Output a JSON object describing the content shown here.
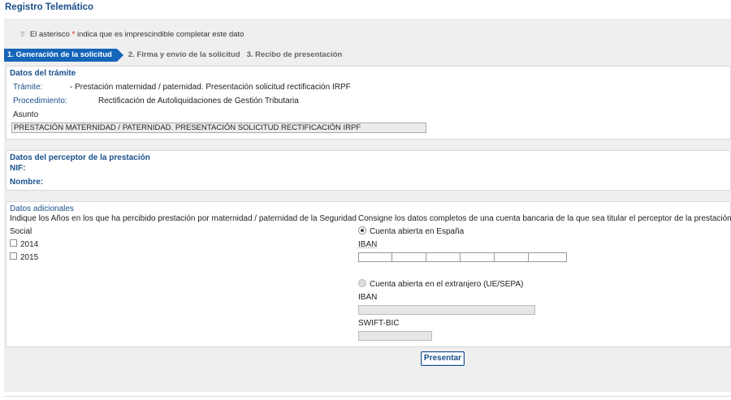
{
  "app_title": "Registro Telemático",
  "note": {
    "prefix": "El asterisco ",
    "asterisk": "*",
    "suffix": " indica que es imprescindible completar este dato"
  },
  "steps": [
    {
      "label": "1. Generación de la solicitud"
    },
    {
      "label": "2. Firma y envío de la solicitud"
    },
    {
      "label": "3. Recibo de presentación"
    }
  ],
  "tramite": {
    "section_title": "Datos del trámite",
    "tramite_label": "Trámite:",
    "tramite_value": "- Prestación maternidad / paternidad. Presentación solicitud rectificación IRPF",
    "procedimiento_label": "Procedimiento:",
    "procedimiento_value": "Rectificación de Autoliquidaciones de Gestión Tributaria",
    "asunto_label": "Asunto",
    "asunto_value": "PRESTACIÓN MATERNIDAD / PATERNIDAD. PRESENTACIÓN SOLICITUD RECTIFICACIÓN IRPF"
  },
  "perceptor": {
    "section_title": "Datos del perceptor de la prestación",
    "nif_label": "NIF:",
    "nombre_label": "Nombre:"
  },
  "adicionales": {
    "section_title": "Datos adicionales",
    "years_prompt_line1": "Indique los Años en los que ha percibido prestación por maternidad / paternidad de la Seguridad",
    "years_prompt_line2": "Social",
    "years": [
      {
        "label": "2014",
        "checked": false
      },
      {
        "label": "2015",
        "checked": false
      }
    ],
    "bank_prompt": "Consigne los datos completos de una cuenta bancaria de la que sea titular el perceptor de la prestación",
    "option_spain": "Cuenta abierta en España",
    "iban_label_spain": "IBAN",
    "option_foreign": "Cuenta abierta en el extranjero (UE/SEPA)",
    "iban_label_foreign": "IBAN",
    "swift_label": "SWIFT-BIC"
  },
  "submit_label": "Presentar"
}
